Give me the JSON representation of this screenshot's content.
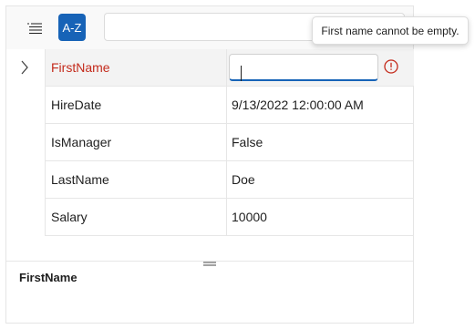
{
  "toolbar": {
    "categorize_icon": "list-icon",
    "sort_label": "A-Z",
    "search_value": "",
    "search_placeholder": ""
  },
  "tooltip": {
    "text": "First name cannot be empty."
  },
  "grid": {
    "rows": [
      {
        "name": "FirstName",
        "value": "",
        "editing": true,
        "error": true
      },
      {
        "name": "HireDate",
        "value": "9/13/2022 12:00:00 AM"
      },
      {
        "name": "IsManager",
        "value": "False"
      },
      {
        "name": "LastName",
        "value": "Doe"
      },
      {
        "name": "Salary",
        "value": "10000"
      }
    ]
  },
  "description": {
    "title": "FirstName"
  },
  "colors": {
    "accent": "#1763b7",
    "error": "#c42b1c"
  }
}
